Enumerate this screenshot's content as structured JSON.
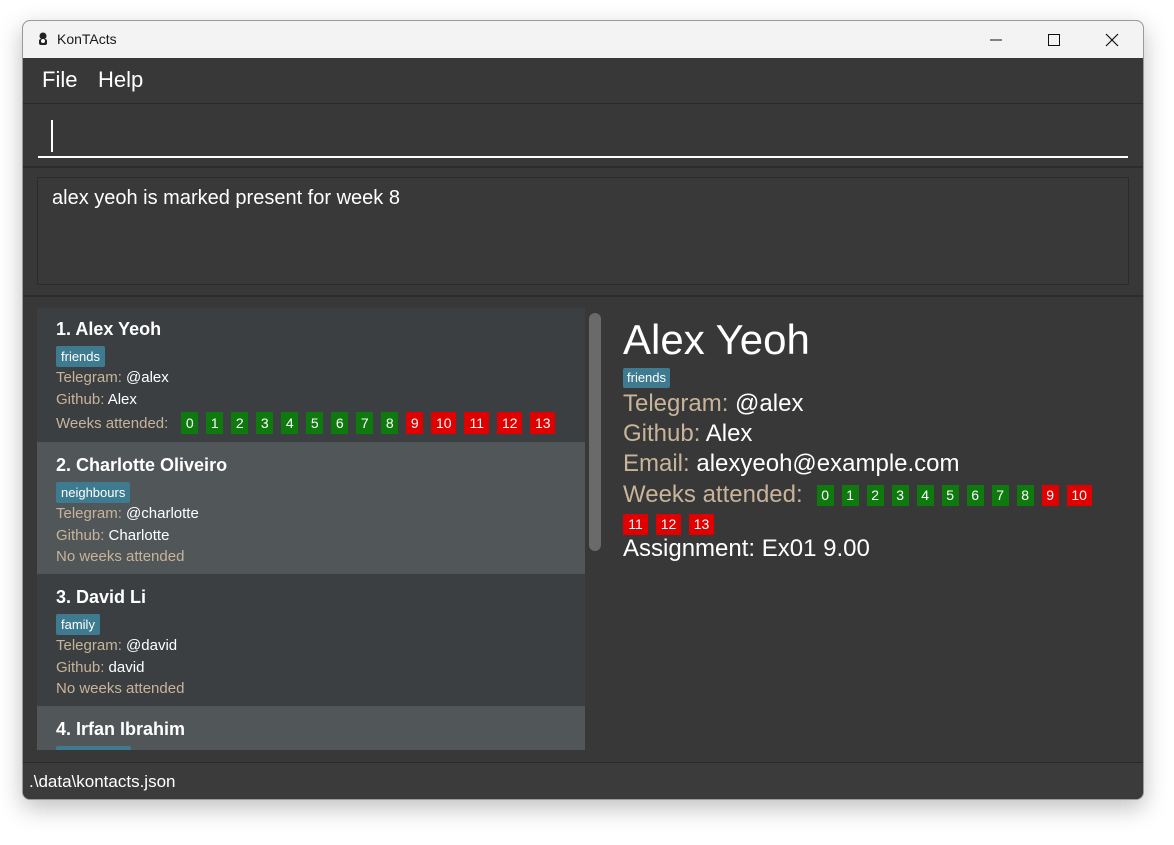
{
  "window": {
    "title": "KonTActs"
  },
  "menu": {
    "file": "File",
    "help": "Help"
  },
  "command": {
    "value": "",
    "placeholder": ""
  },
  "result": {
    "message": "alex yeoh is marked present for week 8"
  },
  "labels": {
    "telegram": "Telegram:",
    "github": "Github:",
    "email": "Email:",
    "weeks_attended": "Weeks attended:",
    "no_weeks": "No weeks attended"
  },
  "persons": [
    {
      "index": "1.",
      "name": "Alex Yeoh",
      "tag": "friends",
      "telegram": "@alex",
      "github": "Alex",
      "weeks": [
        {
          "n": "0",
          "present": true
        },
        {
          "n": "1",
          "present": true
        },
        {
          "n": "2",
          "present": true
        },
        {
          "n": "3",
          "present": true
        },
        {
          "n": "4",
          "present": true
        },
        {
          "n": "5",
          "present": true
        },
        {
          "n": "6",
          "present": true
        },
        {
          "n": "7",
          "present": true
        },
        {
          "n": "8",
          "present": true
        },
        {
          "n": "9",
          "present": false
        },
        {
          "n": "10",
          "present": false
        },
        {
          "n": "11",
          "present": false
        },
        {
          "n": "12",
          "present": false
        },
        {
          "n": "13",
          "present": false
        }
      ]
    },
    {
      "index": "2.",
      "name": "Charlotte Oliveiro",
      "tag": "neighbours",
      "telegram": "@charlotte",
      "github": "Charlotte",
      "weeks": []
    },
    {
      "index": "3.",
      "name": "David Li",
      "tag": "family",
      "telegram": "@david",
      "github": "david",
      "weeks": []
    },
    {
      "index": "4.",
      "name": "Irfan Ibrahim",
      "tag": "",
      "telegram": "",
      "github": "",
      "weeks": []
    }
  ],
  "detail": {
    "name": "Alex Yeoh",
    "tag": "friends",
    "telegram": "@alex",
    "github": "Alex",
    "email": "alexyeoh@example.com",
    "assignment": "Assignment: Ex01 9.00",
    "weeks": [
      {
        "n": "0",
        "present": true
      },
      {
        "n": "1",
        "present": true
      },
      {
        "n": "2",
        "present": true
      },
      {
        "n": "3",
        "present": true
      },
      {
        "n": "4",
        "present": true
      },
      {
        "n": "5",
        "present": true
      },
      {
        "n": "6",
        "present": true
      },
      {
        "n": "7",
        "present": true
      },
      {
        "n": "8",
        "present": true
      },
      {
        "n": "9",
        "present": false
      },
      {
        "n": "10",
        "present": false
      },
      {
        "n": "11",
        "present": false
      },
      {
        "n": "12",
        "present": false
      },
      {
        "n": "13",
        "present": false
      }
    ]
  },
  "status": {
    "path": ".\\data\\kontacts.json"
  },
  "colors": {
    "present": "#0e7a0e",
    "absent": "#e00000",
    "tag": "#3e7b91",
    "label": "#c8b49a"
  }
}
